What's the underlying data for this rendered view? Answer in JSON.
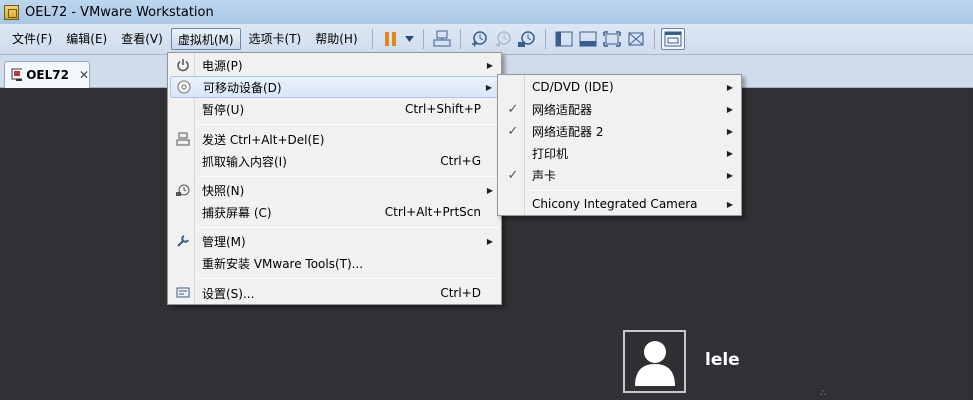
{
  "window": {
    "title": "OEL72 - VMware Workstation"
  },
  "menubar": {
    "items": [
      {
        "label": "文件(F)"
      },
      {
        "label": "编辑(E)"
      },
      {
        "label": "查看(V)"
      },
      {
        "label": "虚拟机(M)"
      },
      {
        "label": "选项卡(T)"
      },
      {
        "label": "帮助(H)"
      }
    ]
  },
  "tab": {
    "label": "OEL72",
    "close": "✕"
  },
  "vm_menu": {
    "items": [
      {
        "label": "电源(P)",
        "icon": "power-icon"
      },
      {
        "label": "可移动设备(D)",
        "icon": "disc-icon"
      },
      {
        "label": "暂停(U)",
        "shortcut": "Ctrl+Shift+P"
      },
      {
        "label": "发送 Ctrl+Alt+Del(E)",
        "icon": "keyboard-icon"
      },
      {
        "label": "抓取输入内容(I)",
        "shortcut": "Ctrl+G"
      },
      {
        "label": "快照(N)",
        "icon": "snapshot-icon"
      },
      {
        "label": "捕获屏幕 (C)",
        "shortcut": "Ctrl+Alt+PrtScn"
      },
      {
        "label": "管理(M)",
        "icon": "wrench-icon"
      },
      {
        "label": "重新安装 VMware Tools(T)..."
      },
      {
        "label": "设置(S)...",
        "shortcut": "Ctrl+D",
        "icon": "settings-icon"
      }
    ]
  },
  "devices_menu": {
    "items": [
      {
        "label": "CD/DVD (IDE)"
      },
      {
        "label": "网络适配器",
        "checked": true
      },
      {
        "label": "网络适配器 2",
        "checked": true
      },
      {
        "label": "打印机"
      },
      {
        "label": "声卡",
        "checked": true
      },
      {
        "label": "Chicony Integrated Camera"
      }
    ]
  },
  "login": {
    "username": "lele"
  },
  "colors": {
    "menu_highlight": "#d8e6f6",
    "check": "#1a4fb0",
    "vm_bg": "#2e3033"
  }
}
